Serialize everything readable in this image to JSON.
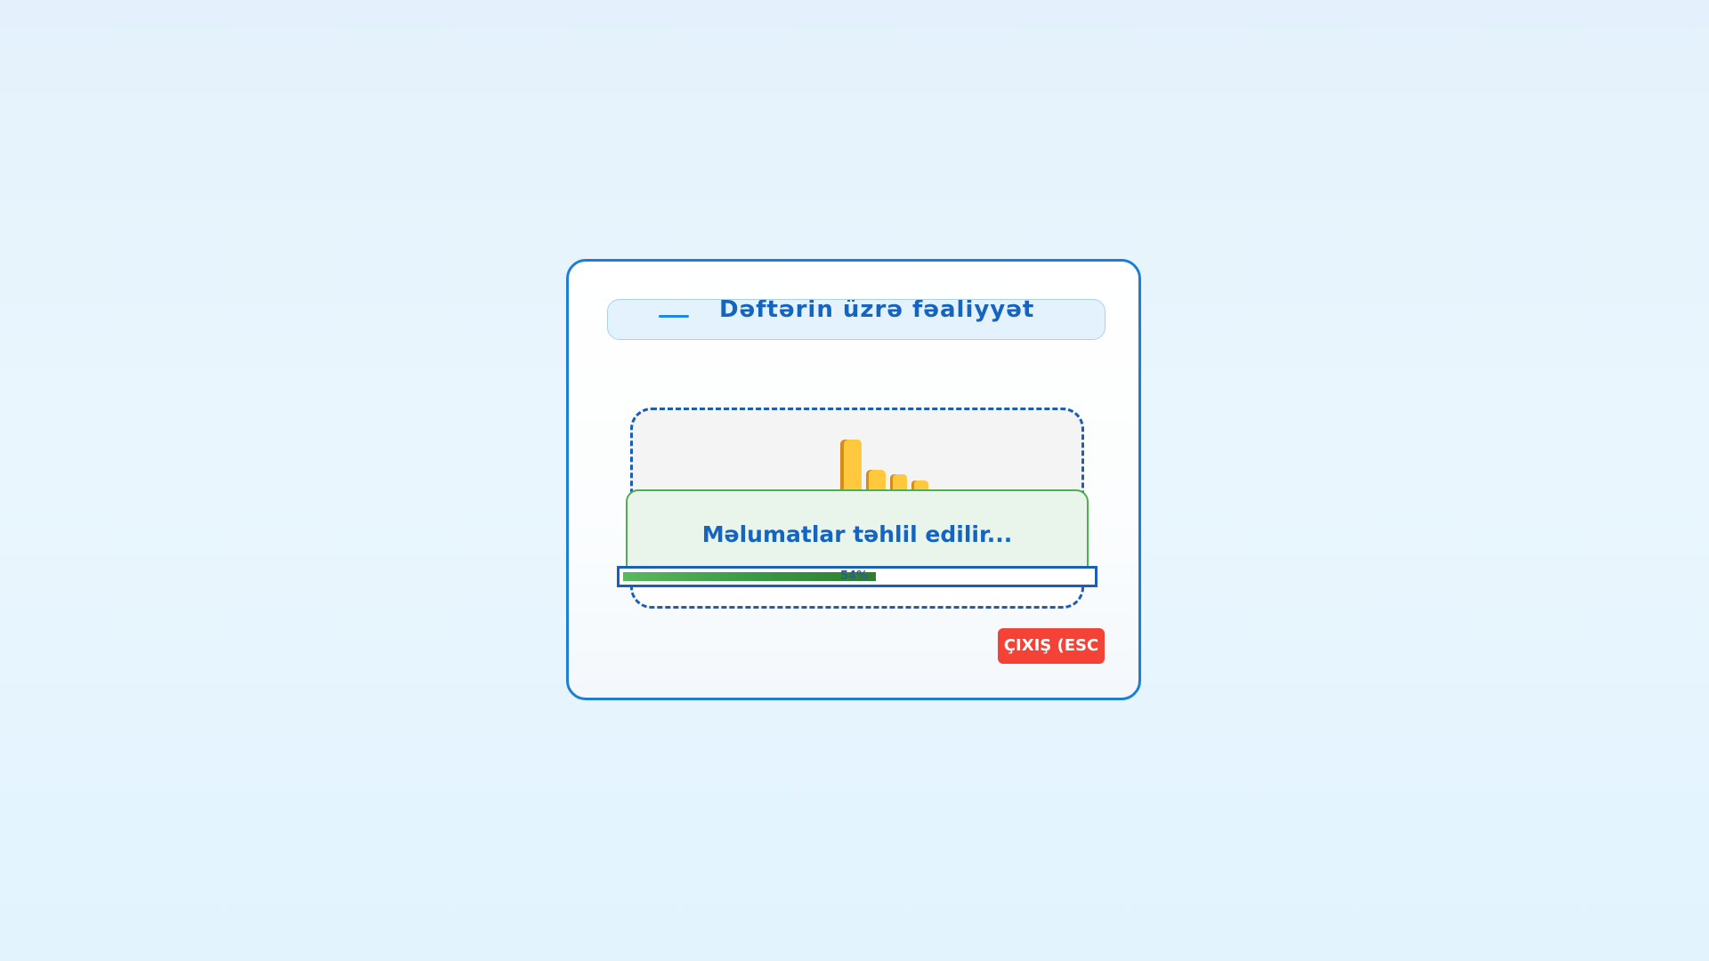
{
  "dialog": {
    "header": {
      "icon": "minus-icon",
      "title": "Dəftərin üzrə fəaliyyət"
    },
    "drop_zone": {
      "icon": "pointing-hand-icon",
      "icon_color": "#ffc83d"
    },
    "status": {
      "message": "Məlumatlar təhlil edilir..."
    },
    "progress": {
      "value": 0.54,
      "label": "54%"
    },
    "exit_button": {
      "label": "ÇIXIŞ (ESC"
    }
  },
  "colors": {
    "accent": "#1e7fd2",
    "title_text": "#1565c0",
    "success": "#4caf50",
    "danger": "#f44336"
  }
}
